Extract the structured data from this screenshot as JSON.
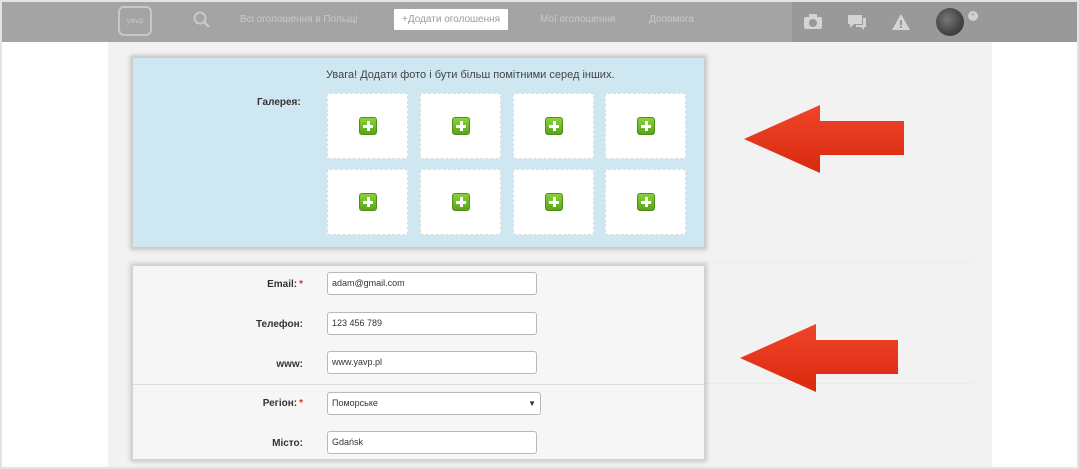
{
  "topbar": {
    "logo_text": "yavp",
    "links": [
      "Всі оголошення в Польщі",
      "+Додати оголошення",
      "Мої оголошення",
      "Допомога"
    ],
    "icons": [
      "search-icon",
      "camera-icon",
      "chat-icon",
      "alert-icon",
      "avatar",
      "notification-badge"
    ]
  },
  "gallery": {
    "notice": "Увага! Додати фото і бути більш помітними серед інших.",
    "label": "Галерея:",
    "slot_count": 8,
    "add_icon": "plus-icon"
  },
  "form": {
    "email_label": "Email:",
    "email_required": "*",
    "email_value": "adam@gmail.com",
    "phone_label": "Телефон:",
    "phone_value": "123 456 789",
    "www_label": "www:",
    "www_value": "www.yavp.pl",
    "region_label": "Регіон:",
    "region_required": "*",
    "region_value": "Поморське",
    "city_label": "Місто:",
    "city_value": "Gdańsk"
  },
  "colors": {
    "arrow": "#e8341c",
    "gallery_bg": "#cfe7f1",
    "plus_green": "#6ebd27",
    "required": "#d9342b"
  }
}
